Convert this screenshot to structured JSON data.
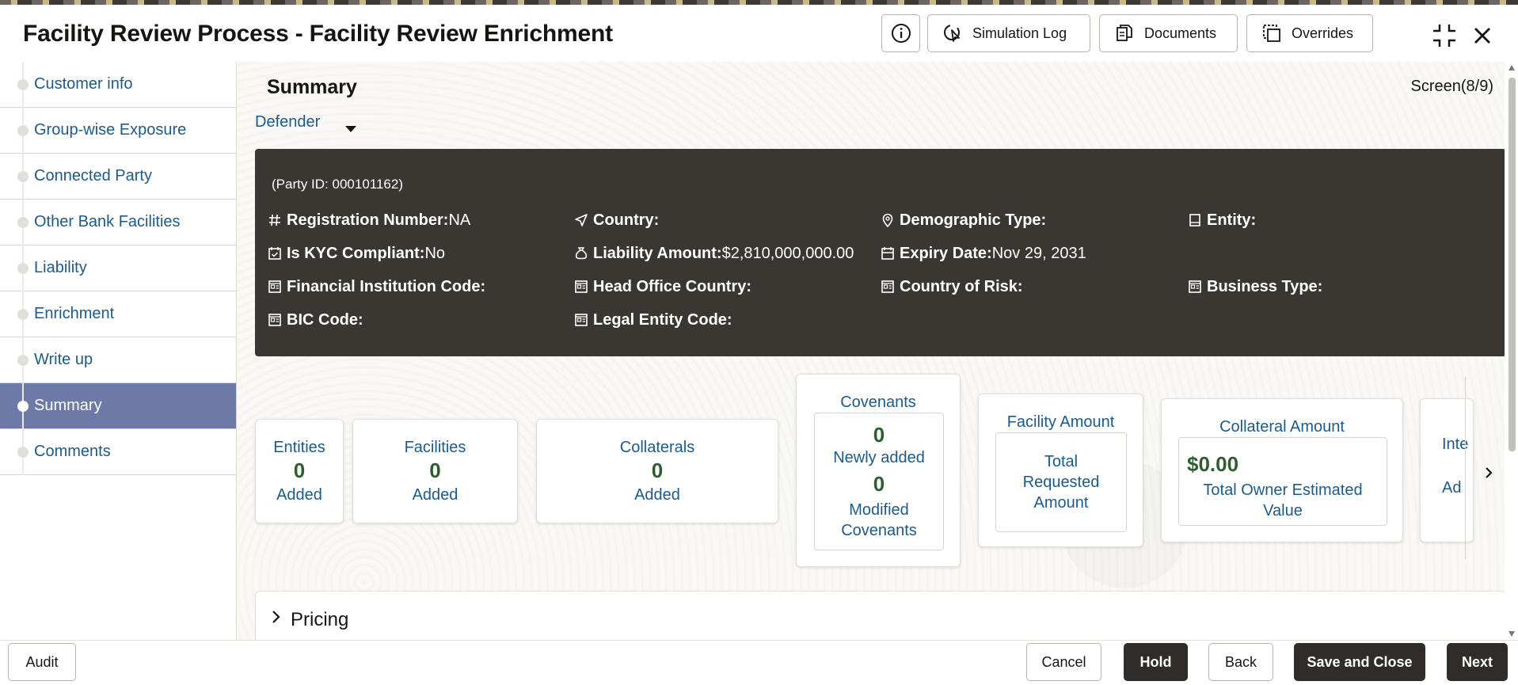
{
  "header": {
    "title": "Facility Review Process - Facility Review Enrichment",
    "buttons": {
      "info_icon": "info-icon",
      "simulation_log": "Simulation Log",
      "documents": "Documents",
      "overrides": "Overrides"
    }
  },
  "sidebar": {
    "items": [
      {
        "label": "Customer info",
        "active": false
      },
      {
        "label": "Group-wise Exposure",
        "active": false
      },
      {
        "label": "Connected Party",
        "active": false
      },
      {
        "label": "Other Bank Facilities",
        "active": false
      },
      {
        "label": "Liability",
        "active": false
      },
      {
        "label": "Enrichment",
        "active": false
      },
      {
        "label": "Write up",
        "active": false
      },
      {
        "label": "Summary",
        "active": true
      },
      {
        "label": "Comments",
        "active": false
      }
    ],
    "active_color": "#6d7aa7"
  },
  "main": {
    "title": "Summary",
    "screen_count": "Screen(8/9)",
    "party_selector": "Defender",
    "info_panel": {
      "party_id": "(Party ID: 000101162)",
      "registration_number": {
        "label": "Registration Number:",
        "value": "NA"
      },
      "country": {
        "label": "Country:",
        "value": ""
      },
      "demographic_type": {
        "label": "Demographic Type:",
        "value": ""
      },
      "entity": {
        "label": "Entity:",
        "value": ""
      },
      "kyc": {
        "label": "Is KYC Compliant:",
        "value": "No"
      },
      "liability_amount": {
        "label": "Liability Amount:",
        "value": "$2,810,000,000.00"
      },
      "expiry_date": {
        "label": "Expiry Date:",
        "value": "Nov 29, 2031"
      },
      "fi_code": {
        "label": "Financial Institution Code:",
        "value": ""
      },
      "head_office_country": {
        "label": "Head Office Country:",
        "value": ""
      },
      "country_of_risk": {
        "label": "Country of Risk:",
        "value": ""
      },
      "business_type": {
        "label": "Business Type:",
        "value": ""
      },
      "bic_code": {
        "label": "BIC Code:",
        "value": ""
      },
      "legal_entity_code": {
        "label": "Legal Entity Code:",
        "value": ""
      },
      "panel_color": "#3a3631"
    },
    "cards": {
      "entities": {
        "title": "Entities",
        "count": "0",
        "sub": "Added"
      },
      "facilities": {
        "title": "Facilities",
        "count": "0",
        "sub": "Added"
      },
      "collaterals": {
        "title": "Collaterals",
        "count": "0",
        "sub": "Added"
      },
      "covenants": {
        "title": "Covenants",
        "new_count": "0",
        "new_label": "Newly added",
        "mod_count": "0",
        "mod_label": "Modified Covenants"
      },
      "facility_amount": {
        "title": "Facility Amount",
        "label": "Total Requested Amount"
      },
      "collateral_amount": {
        "title": "Collateral Amount",
        "value": "$0.00",
        "label": "Total Owner Estimated Value"
      },
      "partial": {
        "title": "Inte",
        "sub": "Ad"
      }
    },
    "pricing_label": "Pricing"
  },
  "footer": {
    "audit": "Audit",
    "cancel": "Cancel",
    "hold": "Hold",
    "back": "Back",
    "save_close": "Save and Close",
    "next": "Next"
  },
  "colors": {
    "link_blue": "#1a5b8e",
    "count_green": "#2c5f2d",
    "dark_button": "#2f2c29"
  }
}
